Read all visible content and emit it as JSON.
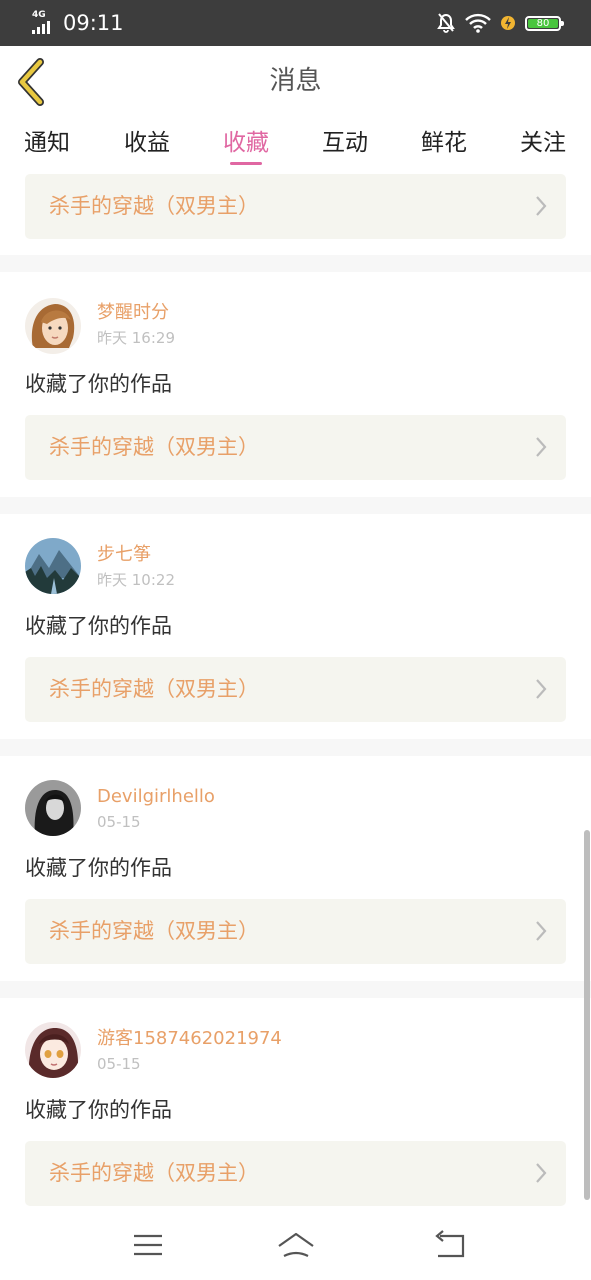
{
  "status": {
    "network": "4G",
    "time": "09:11",
    "battery": "80"
  },
  "nav": {
    "title": "消息"
  },
  "tabs": [
    "通知",
    "收益",
    "收藏",
    "互动",
    "鲜花",
    "关注"
  ],
  "active_tab": "收藏",
  "top_card": {
    "work_title": "杀手的穿越（双男主）"
  },
  "items": [
    {
      "user": "梦醒时分",
      "time": "昨天 16:29",
      "action": "收藏了你的作品",
      "work_title": "杀手的穿越（双男主）"
    },
    {
      "user": "步七筝",
      "time": "昨天 10:22",
      "action": "收藏了你的作品",
      "work_title": "杀手的穿越（双男主）"
    },
    {
      "user": "Devilgirlhello",
      "time": "05-15",
      "action": "收藏了你的作品",
      "work_title": "杀手的穿越（双男主）"
    },
    {
      "user": "游客1587462021974",
      "time": "05-15",
      "action": "收藏了你的作品",
      "work_title": "杀手的穿越（双男主）"
    }
  ],
  "colors": {
    "accent": "#e067a2",
    "name": "#e8a068",
    "card_bg": "#f5f5ef",
    "back_arrow": "#e8c840"
  },
  "icons": [
    "back-arrow-icon",
    "chevron-right-icon",
    "menu-icon",
    "home-icon",
    "return-icon",
    "wifi-icon",
    "mute-bell-icon",
    "charging-icon"
  ]
}
